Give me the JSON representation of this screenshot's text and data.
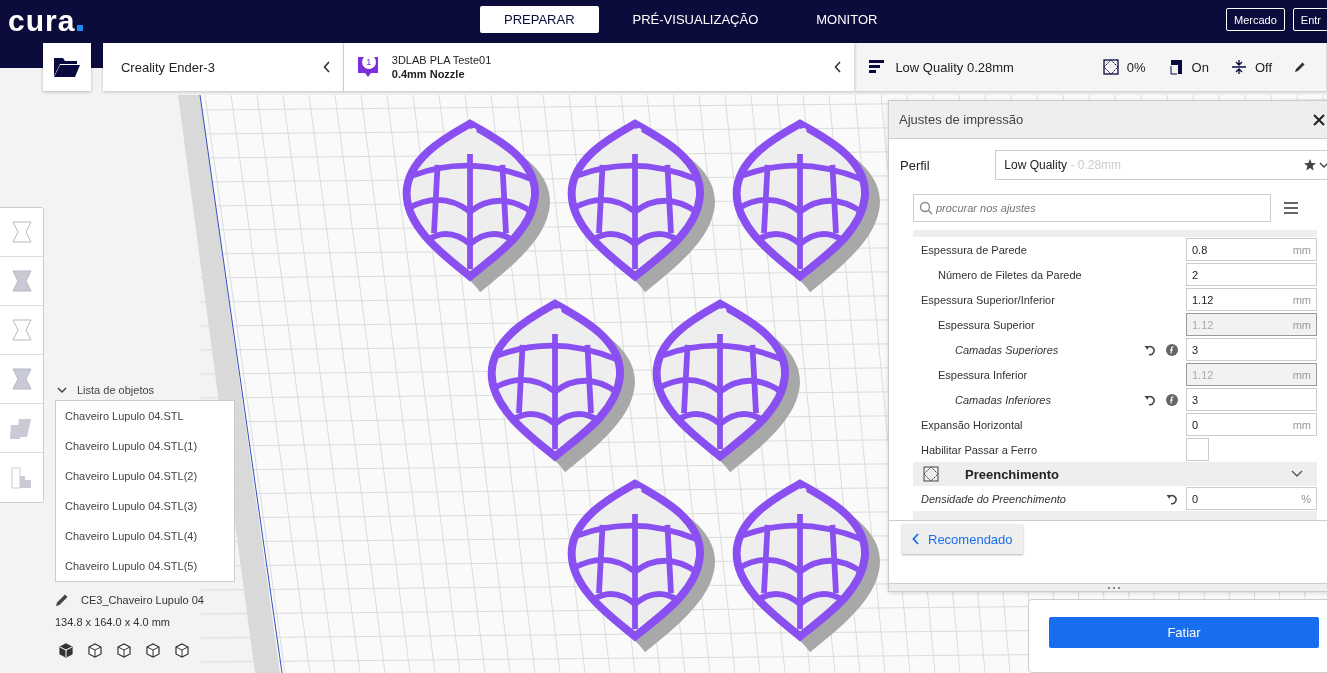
{
  "header": {
    "logo": "cura",
    "tabs": [
      {
        "label": "PREPARAR",
        "selected": true
      },
      {
        "label": "PRÉ-VISUALIZAÇÃO",
        "selected": false
      },
      {
        "label": "MONITOR",
        "selected": false
      }
    ],
    "right_buttons": [
      "Mercado",
      "Entr"
    ]
  },
  "stage_bar": {
    "printer": "Creality Ender-3",
    "material": {
      "badge": "1",
      "name": "3DLAB PLA Teste01",
      "nozzle": "0.4mm Nozzle"
    },
    "summary": {
      "profile": "Low Quality 0.28mm",
      "infill": "0%",
      "support": "On",
      "adhesion": "Off"
    }
  },
  "settings_panel": {
    "title": "Ajustes de impressão",
    "profile_label": "Perfil",
    "profile_name": "Low Quality",
    "profile_detail": "- 0.28mm",
    "search": {
      "placeholder": "procurar nos ajustes"
    },
    "sections": [
      {
        "kind": "cut",
        "settings": [
          {
            "label": "Espessura de Parede",
            "kind": "field",
            "value": "0.8",
            "unit": "mm",
            "disabled": false,
            "italic": false,
            "resettable": false,
            "inherited": false,
            "children": [
              {
                "label": "Número de Filetes da Parede",
                "kind": "field",
                "value": "2",
                "disabled": false,
                "italic": false,
                "resettable": false,
                "inherited": false
              }
            ]
          },
          {
            "label": "Espessura Superior/Inferior",
            "kind": "field",
            "value": "1.12",
            "unit": "mm",
            "disabled": false,
            "italic": false,
            "resettable": false,
            "inherited": false,
            "children": [
              {
                "label": "Espessura Superior",
                "kind": "field",
                "value": "1.12",
                "unit": "mm",
                "disabled": true,
                "italic": false,
                "resettable": false,
                "inherited": false,
                "children": [
                  {
                    "label": "Camadas Superiores",
                    "kind": "field",
                    "value": "3",
                    "disabled": false,
                    "italic": true,
                    "resettable": true,
                    "inherited": true
                  }
                ]
              },
              {
                "label": "Espessura Inferior",
                "kind": "field",
                "value": "1.12",
                "unit": "mm",
                "disabled": true,
                "italic": false,
                "resettable": false,
                "inherited": false,
                "children": [
                  {
                    "label": "Camadas Inferiores",
                    "kind": "field",
                    "value": "3",
                    "disabled": false,
                    "italic": true,
                    "resettable": true,
                    "inherited": true
                  }
                ]
              }
            ]
          },
          {
            "label": "Expansão Horizontal",
            "kind": "field",
            "value": "0",
            "unit": "mm",
            "disabled": false,
            "italic": false,
            "resettable": false,
            "inherited": false
          },
          {
            "label": "Habilitar Passar a Ferro",
            "kind": "checkbox",
            "checked": false,
            "italic": false,
            "resettable": false,
            "inherited": false
          }
        ]
      },
      {
        "kind": "infill",
        "title": "Preenchimento",
        "settings": [
          {
            "label": "Densidade do Preenchimento",
            "kind": "field",
            "value": "0",
            "unit": "%",
            "disabled": false,
            "italic": true,
            "resettable": true,
            "inherited": false
          }
        ]
      },
      {
        "kind": "material_cut"
      }
    ],
    "back_button": "Recomendado"
  },
  "slice_button": "Fatiar",
  "object_list": {
    "title": "Lista de objetos",
    "expanded": true,
    "items": [
      "Chaveiro Lupulo 04.STL",
      "Chaveiro Lupulo 04.STL(1)",
      "Chaveiro Lupulo 04.STL(2)",
      "Chaveiro Lupulo 04.STL(3)",
      "Chaveiro Lupulo 04.STL(4)",
      "Chaveiro Lupulo 04.STL(5)"
    ]
  },
  "model": {
    "name": "CE3_Chaveiro Lupulo 04",
    "dimensions": "134.8 x 164.0 x 4.0 mm"
  }
}
